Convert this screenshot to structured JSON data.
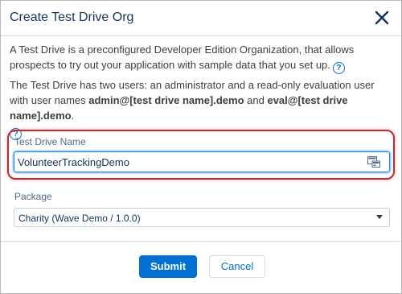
{
  "dialog": {
    "title": "Create Test Drive Org",
    "close_icon": "close-icon"
  },
  "intro": {
    "text": "A Test Drive is a preconfigured Developer Edition Organization, that allows prospects to try out your application with sample data that you set up.",
    "help_icon": "help-icon",
    "help_glyph": "?"
  },
  "users": {
    "text_before": "The Test Drive has two users: an administrator and a read-only evaluation user with user names ",
    "admin_user": "admin@[test drive name].demo",
    "text_middle": " and ",
    "eval_user": "eval@[test drive name].demo",
    "text_after": ".",
    "help_icon": "help-icon",
    "help_glyph": "?"
  },
  "form": {
    "name_label": "Test Drive Name",
    "name_value": "VolunteerTrackingDemo",
    "name_icon": "generate-name-icon",
    "package_label": "Package",
    "package_value": "Charity (Wave Demo / 1.0.0)"
  },
  "footer": {
    "submit_label": "Submit",
    "cancel_label": "Cancel"
  },
  "colors": {
    "brand": "#0070d2",
    "highlight": "#c7282f",
    "text": "#16325c"
  }
}
